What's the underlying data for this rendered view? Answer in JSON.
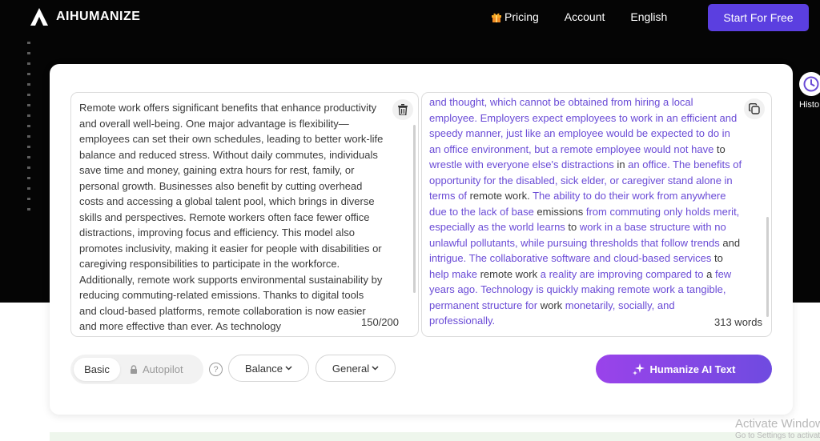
{
  "header": {
    "logo_text": "AIHUMANIZE",
    "nav": {
      "pricing": "Pricing",
      "account": "Account",
      "language": "English"
    },
    "cta": "Start For Free"
  },
  "sidebar": {
    "history_label": "Histo"
  },
  "editor": {
    "input_text": "Remote work offers significant benefits that enhance productivity and overall well-being. One major advantage is flexibility—employees can set their own schedules, leading to better work-life balance and reduced stress. Without daily commutes, individuals save time and money, gaining extra hours for rest, family, or personal growth. Businesses also benefit by cutting overhead costs and accessing a global talent pool, which brings in diverse skills and perspectives. Remote workers often face fewer office distractions, improving focus and efficiency. This model also promotes inclusivity, making it easier for people with disabilities or caregiving responsibilities to participate in the workforce. Additionally, remote work supports environmental sustainability by reducing commuting-related emissions. Thanks to digital tools and cloud-based platforms, remote collaboration is now easier and more effective than ever. As technology",
    "input_count": "150/200",
    "output_segments": [
      {
        "text": "and thought, which cannot be obtained from hiring a local employee. Employers expect employees to work in an efficient and speedy manner, just like an employee would be expected to do in an office environment, but a remote employee would not have",
        "p": true
      },
      {
        "text": " to ",
        "p": false
      },
      {
        "text": "wrestle with everyone else's distractions",
        "p": true
      },
      {
        "text": " in ",
        "p": false
      },
      {
        "text": "an office. The benefits of opportunity for the disabled, sick elder, or caregiver stand alone in terms of",
        "p": true
      },
      {
        "text": " remote work. ",
        "p": false
      },
      {
        "text": "The ability to do their work from anywhere due to the lack of base",
        "p": true
      },
      {
        "text": " emissions ",
        "p": false
      },
      {
        "text": "from commuting only holds merit, especially as the world learns",
        "p": true
      },
      {
        "text": " to ",
        "p": false
      },
      {
        "text": "work in a base structure with no unlawful pollutants, while pursuing thresholds that follow trends",
        "p": true
      },
      {
        "text": " and ",
        "p": false
      },
      {
        "text": "intrigue. The collaborative software and cloud-based services",
        "p": true
      },
      {
        "text": " to ",
        "p": false
      },
      {
        "text": "help make",
        "p": true
      },
      {
        "text": " remote work ",
        "p": false
      },
      {
        "text": "a reality are improving compared to",
        "p": true
      },
      {
        "text": " a ",
        "p": false
      },
      {
        "text": "few years ago. Technology is quickly making remote work a tangible, permanent structure for",
        "p": true
      },
      {
        "text": " work ",
        "p": false
      },
      {
        "text": "monetarily, socially, and professionally.",
        "p": true
      }
    ],
    "output_count": "313 words"
  },
  "controls": {
    "mode_basic": "Basic",
    "mode_autopilot": "Autopilot",
    "help": "?",
    "balance": "Balance",
    "general": "General",
    "humanize": "Humanize AI Text"
  },
  "watermark": {
    "title": "Activate Windows",
    "subtitle": "Go to Settings to activate Windows."
  },
  "colors": {
    "accent": "#5b3fe0",
    "paraphrase": "#6a4bd6",
    "gradient_start": "#9a43ea",
    "gradient_end": "#6f4be0"
  }
}
